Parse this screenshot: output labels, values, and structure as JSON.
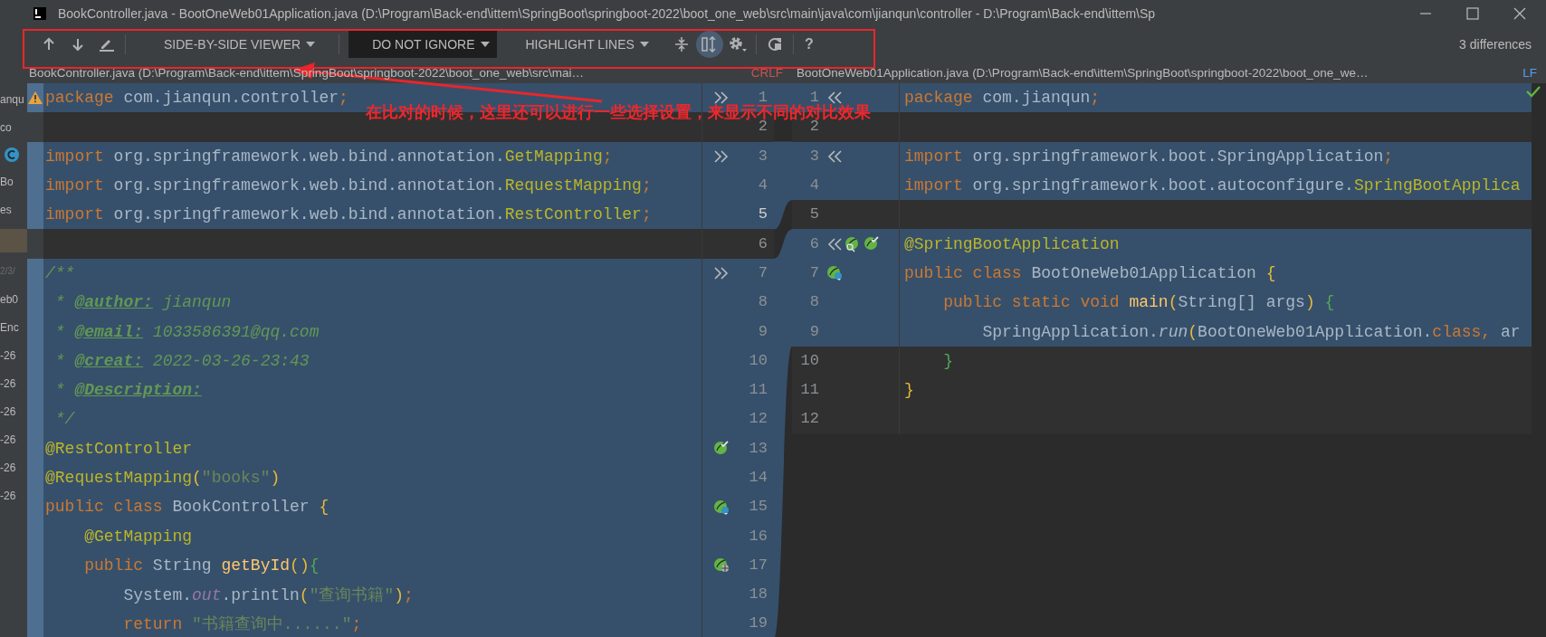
{
  "window": {
    "title": "BookController.java - BootOneWeb01Application.java (D:\\Program\\Back-end\\ittem\\SpringBoot\\springboot-2022\\boot_one_web\\src\\main\\java\\com\\jianqun\\controller - D:\\Program\\Back-end\\ittem\\Sp"
  },
  "toolbar": {
    "viewer": "SIDE-BY-SIDE VIEWER",
    "ignore": "DO NOT IGNORE",
    "highlight": "HIGHLIGHT LINES",
    "sync_scroll": {
      "selected": true
    },
    "help": "?",
    "differences": "3 differences"
  },
  "background_panel": {
    "items": [
      {
        "text": "anqu",
        "kind": "plain"
      },
      {
        "text": "co",
        "kind": "plain"
      },
      {
        "kind": "class-icon"
      },
      {
        "text": "Bo",
        "kind": "plain"
      },
      {
        "text": "es",
        "kind": "plain"
      },
      {
        "kind": "block"
      },
      {
        "text": "2/3/",
        "kind": "faint"
      },
      {
        "text": "eb0",
        "kind": "plain"
      },
      {
        "text": "Enc",
        "kind": "plain"
      },
      {
        "text": "-26",
        "kind": "plain"
      },
      {
        "text": "-26",
        "kind": "plain"
      },
      {
        "text": "-26",
        "kind": "plain"
      },
      {
        "text": "-26",
        "kind": "plain"
      },
      {
        "text": "-26",
        "kind": "plain"
      },
      {
        "text": "-26",
        "kind": "plain"
      }
    ]
  },
  "left_file": {
    "path": "BookController.java (D:\\Program\\Back-end\\ittem\\SpringBoot\\springboot-2022\\boot_one_web\\src\\mai…",
    "line_separator": "CRLF",
    "lines": [
      {
        "number": "1",
        "changed": true,
        "current": false,
        "markers": [
          {
            "kind": "merge-right"
          }
        ],
        "tokens": [
          {
            "kind": "kw",
            "text": "package"
          },
          {
            "kind": "plain",
            "text": " com.jianqun.controller"
          },
          {
            "kind": "semi",
            "text": ";"
          }
        ]
      },
      {
        "number": "2",
        "changed": false,
        "current": false
      },
      {
        "number": "3",
        "changed": true,
        "current": false,
        "markers": [
          {
            "kind": "merge-right"
          }
        ],
        "tokens": [
          {
            "kind": "kw",
            "text": "import"
          },
          {
            "kind": "plain",
            "text": " org.springframework.web.bind.annotation."
          },
          {
            "kind": "ann",
            "text": "GetMapping"
          },
          {
            "kind": "semi",
            "text": ";"
          }
        ]
      },
      {
        "number": "4",
        "changed": true,
        "current": false,
        "tokens": [
          {
            "kind": "kw",
            "text": "import"
          },
          {
            "kind": "plain",
            "text": " org.springframework.web.bind.annotation."
          },
          {
            "kind": "ann",
            "text": "RequestMapping"
          },
          {
            "kind": "semi",
            "text": ";"
          }
        ]
      },
      {
        "number": "5",
        "changed": true,
        "current": true,
        "tokens": [
          {
            "kind": "kw",
            "text": "import"
          },
          {
            "kind": "plain",
            "text": " org.springframework.web.bind.annotation."
          },
          {
            "kind": "ann",
            "text": "RestController"
          },
          {
            "kind": "semi",
            "text": ";"
          }
        ]
      },
      {
        "number": "6",
        "changed": false,
        "current": false
      },
      {
        "number": "7",
        "changed": true,
        "current": false,
        "markers": [
          {
            "kind": "merge-right"
          }
        ],
        "tokens": [
          {
            "kind": "doc",
            "text": "/**"
          }
        ]
      },
      {
        "number": "8",
        "changed": true,
        "current": false,
        "tokens": [
          {
            "kind": "doc",
            "text": " * "
          },
          {
            "kind": "doctag",
            "text": "@author:"
          },
          {
            "kind": "doc",
            "text": " jianqun"
          }
        ]
      },
      {
        "number": "9",
        "changed": true,
        "current": false,
        "tokens": [
          {
            "kind": "doc",
            "text": " * "
          },
          {
            "kind": "doctag",
            "text": "@email:"
          },
          {
            "kind": "doc",
            "text": " 1033586391@qq.com"
          }
        ]
      },
      {
        "number": "10",
        "changed": true,
        "current": false,
        "tokens": [
          {
            "kind": "doc",
            "text": " * "
          },
          {
            "kind": "doctag",
            "text": "@creat:"
          },
          {
            "kind": "doc",
            "text": " 2022-03-26-23:43"
          }
        ]
      },
      {
        "number": "11",
        "changed": true,
        "current": false,
        "tokens": [
          {
            "kind": "doc",
            "text": " * "
          },
          {
            "kind": "doctag",
            "text": "@Description:"
          }
        ]
      },
      {
        "number": "12",
        "changed": true,
        "current": false,
        "tokens": [
          {
            "kind": "doc",
            "text": " */"
          }
        ]
      },
      {
        "number": "13",
        "changed": true,
        "current": false,
        "markers": [
          {
            "kind": "bean-check"
          }
        ],
        "tokens": [
          {
            "kind": "ann",
            "text": "@RestController"
          }
        ]
      },
      {
        "number": "14",
        "changed": true,
        "current": false,
        "tokens": [
          {
            "kind": "ann",
            "text": "@RequestMapping"
          },
          {
            "kind": "bracket",
            "text": "("
          },
          {
            "kind": "str",
            "text": "\"books\""
          },
          {
            "kind": "bracket",
            "text": ")"
          }
        ]
      },
      {
        "number": "15",
        "changed": true,
        "current": false,
        "markers": [
          {
            "kind": "bean-class"
          }
        ],
        "tokens": [
          {
            "kind": "kw",
            "text": "public class "
          },
          {
            "kind": "plain",
            "text": "BookController "
          },
          {
            "kind": "bracket",
            "text": "{"
          }
        ]
      },
      {
        "number": "16",
        "changed": true,
        "current": false,
        "tokens": [
          {
            "kind": "ann",
            "text": "    @GetMapping"
          }
        ]
      },
      {
        "number": "17",
        "changed": true,
        "current": false,
        "markers": [
          {
            "kind": "bean-web"
          }
        ],
        "tokens": [
          {
            "kind": "kw",
            "text": "    public "
          },
          {
            "kind": "plain",
            "text": "String "
          },
          {
            "kind": "method",
            "text": "getById"
          },
          {
            "kind": "bracket",
            "text": "()"
          },
          {
            "kind": "brace2",
            "text": "{"
          }
        ]
      },
      {
        "number": "18",
        "changed": true,
        "current": false,
        "tokens": [
          {
            "kind": "plain",
            "text": "        System."
          },
          {
            "kind": "field",
            "text": "out"
          },
          {
            "kind": "plain",
            "text": ".println"
          },
          {
            "kind": "bracket",
            "text": "("
          },
          {
            "kind": "str",
            "text": "\"查询书籍\""
          },
          {
            "kind": "bracket",
            "text": ")"
          },
          {
            "kind": "semi",
            "text": ";"
          }
        ]
      },
      {
        "number": "19",
        "changed": true,
        "current": false,
        "tokens": [
          {
            "kind": "kw",
            "text": "        return "
          },
          {
            "kind": "str",
            "text": "\"书籍查询中......\""
          },
          {
            "kind": "semi",
            "text": ";"
          }
        ]
      }
    ]
  },
  "right_file": {
    "path": "BootOneWeb01Application.java (D:\\Program\\Back-end\\ittem\\SpringBoot\\springboot-2022\\boot_one_we…",
    "line_separator": "LF",
    "lines": [
      {
        "number": "1",
        "changed": true,
        "current": false,
        "markers": [
          {
            "kind": "merge-left"
          }
        ],
        "tokens": [
          {
            "kind": "kw",
            "text": "package"
          },
          {
            "kind": "plain",
            "text": " com.jianqun"
          },
          {
            "kind": "semi",
            "text": ";"
          }
        ]
      },
      {
        "number": "2",
        "changed": false,
        "current": false
      },
      {
        "number": "3",
        "changed": true,
        "current": false,
        "markers": [
          {
            "kind": "merge-left"
          }
        ],
        "tokens": [
          {
            "kind": "kw",
            "text": "import"
          },
          {
            "kind": "plain",
            "text": " org.springframework.boot.SpringApplication"
          },
          {
            "kind": "semi",
            "text": ";"
          }
        ]
      },
      {
        "number": "4",
        "changed": true,
        "current": false,
        "tokens": [
          {
            "kind": "kw",
            "text": "import"
          },
          {
            "kind": "plain",
            "text": " org.springframework.boot.autoconfigure."
          },
          {
            "kind": "ann",
            "text": "SpringBootApplica"
          }
        ]
      },
      {
        "number": "5",
        "changed": false,
        "current": false
      },
      {
        "number": "6",
        "changed": true,
        "current": false,
        "markers": [
          {
            "kind": "merge-left"
          },
          {
            "kind": "bean-search"
          },
          {
            "kind": "bean-check"
          }
        ],
        "tokens": [
          {
            "kind": "ann",
            "text": "@SpringBootApplication"
          }
        ]
      },
      {
        "number": "7",
        "changed": true,
        "current": false,
        "markers": [
          {
            "kind": "bean-class"
          }
        ],
        "tokens": [
          {
            "kind": "kw",
            "text": "public class "
          },
          {
            "kind": "plain",
            "text": "BootOneWeb01Application "
          },
          {
            "kind": "bracket",
            "text": "{"
          }
        ]
      },
      {
        "number": "8",
        "changed": true,
        "current": false,
        "tokens": [
          {
            "kind": "kw",
            "text": "    public static void "
          },
          {
            "kind": "method",
            "text": "main"
          },
          {
            "kind": "bracket",
            "text": "("
          },
          {
            "kind": "plain",
            "text": "String[] args"
          },
          {
            "kind": "bracket",
            "text": ")"
          },
          {
            "kind": "brace2",
            "text": " {"
          }
        ]
      },
      {
        "number": "9",
        "changed": true,
        "current": false,
        "tokens": [
          {
            "kind": "plain",
            "text": "        SpringApplication."
          },
          {
            "kind": "call",
            "text": "run"
          },
          {
            "kind": "bracket",
            "text": "("
          },
          {
            "kind": "plain",
            "text": "BootOneWeb01Application."
          },
          {
            "kind": "kw",
            "text": "class"
          },
          {
            "kind": "semi",
            "text": ","
          },
          {
            "kind": "plain",
            "text": " ar"
          }
        ]
      },
      {
        "number": "10",
        "changed": false,
        "current": false,
        "tokens": [
          {
            "kind": "brace2",
            "text": "    }"
          }
        ]
      },
      {
        "number": "11",
        "changed": false,
        "current": false,
        "tokens": [
          {
            "kind": "bracket",
            "text": "}"
          }
        ]
      },
      {
        "number": "12",
        "changed": false,
        "current": false
      }
    ]
  },
  "annotation": {
    "text": "在比对的时候，这里还可以进行一些选择设置，来显示不同的对比效果"
  }
}
